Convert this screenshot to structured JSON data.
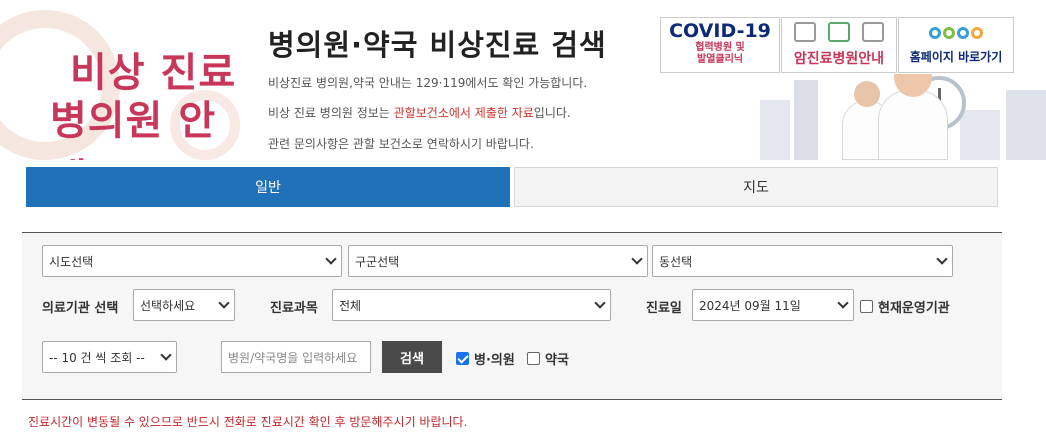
{
  "header": {
    "logo_line1": "비상 진료",
    "logo_line2": "병의원 안내",
    "title": "병의원·약국 비상진료 검색",
    "info1": "비상진료 병의원,약국 안내는 129·119에서도 확인 가능합니다.",
    "info2_pre": "비상 진료 병의원 정보는 ",
    "info2_red": "관할보건소에서 제출한 자료",
    "info2_post": "입니다.",
    "info3": "관련 문의사항은 관할 보건소로 연락하시기 바랍니다."
  },
  "banners": {
    "covid_title": "COVID-19",
    "covid_line1": "협력병원 및",
    "covid_line2": "발열클리닉",
    "cancer": "암진료병원안내",
    "home": "홈페이지 바로가기"
  },
  "tabs": [
    {
      "label": "일반",
      "active": true
    },
    {
      "label": "지도",
      "active": false
    }
  ],
  "search": {
    "sido": "시도선택",
    "gugun": "구군선택",
    "dong": "동선택",
    "org_type_label": "의료기관 선택",
    "org_type_value": "선택하세요",
    "dept_label": "진료과목",
    "dept_value": "전체",
    "date_label": "진료일",
    "date_value": "2024년 09월 11일",
    "open_now_label": "현재운영기관",
    "page_size": "-- 10 건 씩 조회 --",
    "keyword_placeholder": "병원/약국명을 입력하세요",
    "search_button": "검색",
    "hospital_label": "병·의원",
    "pharmacy_label": "약국",
    "hospital_checked": true,
    "pharmacy_checked": false,
    "open_now_checked": false
  },
  "notice": "진료시간이 변동될 수 있으므로 반드시 전화로 진료시간 확인 후 방문해주시기 바랍니다.",
  "colors": {
    "accent": "#2071b8",
    "brand_red": "#c8375a",
    "notice_red": "#c0282d"
  }
}
